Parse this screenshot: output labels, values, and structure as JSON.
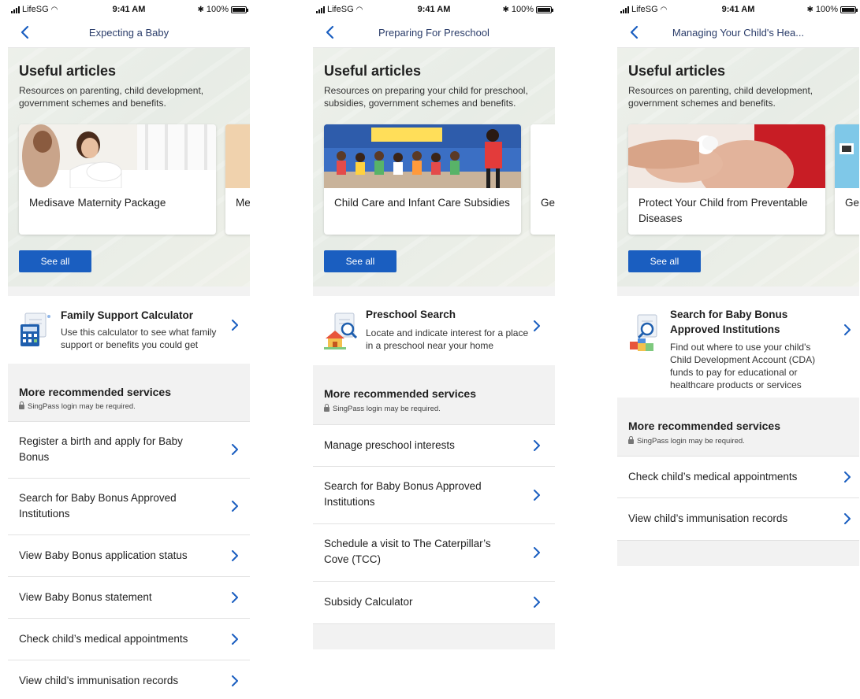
{
  "status_bar": {
    "carrier": "LifeSG",
    "time": "9:41 AM",
    "battery": "100%"
  },
  "screens": [
    {
      "nav_title": "Expecting a Baby",
      "section_title": "Useful articles",
      "section_description": "Resources on parenting, child development, government schemes and benefits.",
      "cards": [
        {
          "title": "Medisave Maternity Package"
        },
        {
          "title": "Me"
        }
      ],
      "see_all_label": "See all",
      "feature": {
        "title": "Family Support Calculator",
        "description": "Use this calculator to see what family support or benefits you could get",
        "icon": "calculator-icon"
      },
      "more_title": "More recommended services",
      "more_note": "SingPass login may be required.",
      "services": [
        {
          "label": "Register a birth and apply for Baby Bonus"
        },
        {
          "label": "Search for Baby Bonus Approved Institutions"
        },
        {
          "label": "View Baby Bonus application status"
        },
        {
          "label": "View Baby Bonus statement"
        },
        {
          "label": "Check child’s medical appointments"
        },
        {
          "label": "View child’s immunisation records"
        }
      ]
    },
    {
      "nav_title": "Preparing For Preschool",
      "section_title": "Useful articles",
      "section_description": "Resources on preparing your child for preschool, subsidies, government schemes and benefits.",
      "cards": [
        {
          "title": "Child Care and Infant Care Subsidies"
        },
        {
          "title": "Ge go"
        }
      ],
      "see_all_label": "See all",
      "feature": {
        "title": "Preschool Search",
        "description": "Locate and indicate interest for a place in a preschool near your home",
        "icon": "preschool-search-icon"
      },
      "more_title": "More recommended services",
      "more_note": "SingPass login may be required.",
      "services": [
        {
          "label": "Manage preschool interests"
        },
        {
          "label": "Search for Baby Bonus Approved Institutions"
        },
        {
          "label": "Schedule a visit to The Caterpillar’s Cove (TCC)"
        },
        {
          "label": "Subsidy Calculator"
        }
      ]
    },
    {
      "nav_title": "Managing Your Child's Hea...",
      "section_title": "Useful articles",
      "section_description": "Resources on parenting, child development, government schemes and benefits.",
      "cards": [
        {
          "title": "Protect Your Child from Preventable Diseases"
        },
        {
          "title": "Ge fin"
        }
      ],
      "see_all_label": "See all",
      "feature": {
        "title": "Search for Baby Bonus Approved Institutions",
        "description": "Find out where to use your child's Child Development Account (CDA) funds to pay for educational or healthcare products or services",
        "icon": "institution-search-icon"
      },
      "more_title": "More recommended services",
      "more_note": "SingPass login may be required.",
      "services": [
        {
          "label": "Check child’s medical appointments"
        },
        {
          "label": "View child’s immunisation records"
        }
      ]
    }
  ]
}
